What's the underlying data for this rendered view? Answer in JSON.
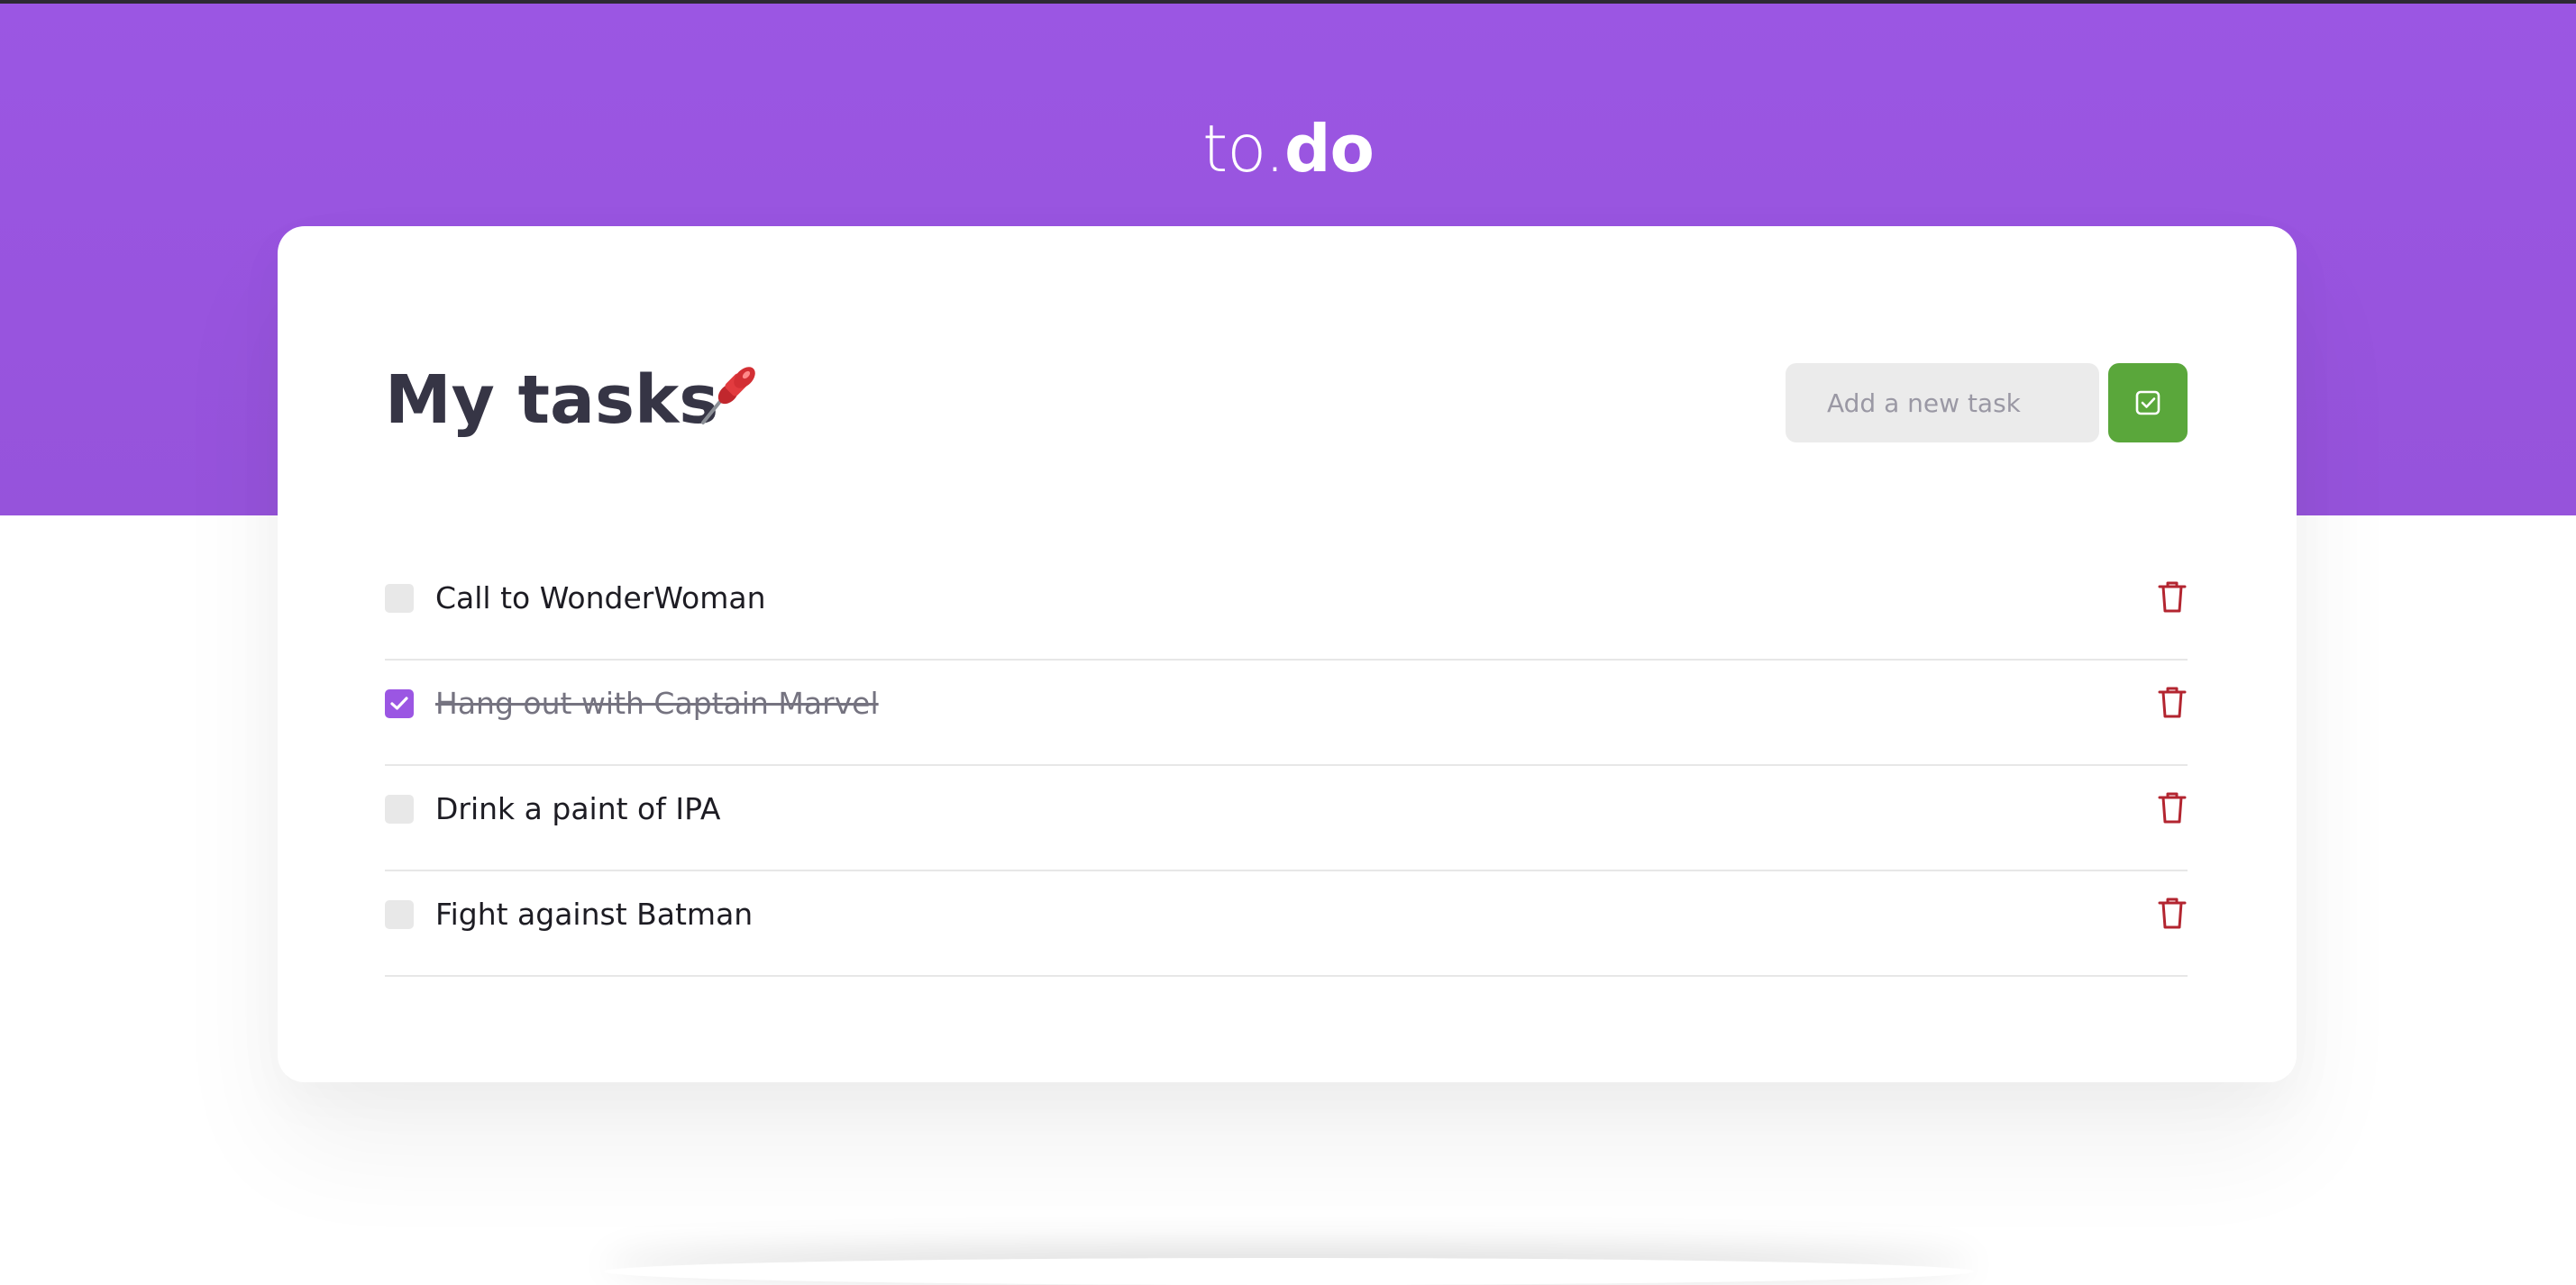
{
  "app": {
    "logo_light": "to.",
    "logo_bold": "do"
  },
  "card": {
    "title": "My tasks",
    "title_icon": "pushpin-icon"
  },
  "new_task": {
    "placeholder": "Add a new task",
    "value": "",
    "submit_icon": "check-square-icon"
  },
  "tasks": [
    {
      "label": "Call to WonderWoman",
      "completed": false
    },
    {
      "label": "Hang out with Captain Marvel",
      "completed": true
    },
    {
      "label": "Drink a paint of IPA",
      "completed": false
    },
    {
      "label": "Fight against Batman",
      "completed": false
    }
  ],
  "icons": {
    "checkbox": "checkmark-icon",
    "delete": "trash-icon"
  },
  "colors": {
    "brand_purple": "#9b56e3",
    "add_button_green": "#5aa73b",
    "delete_red": "#b32530",
    "title_text": "#363545"
  }
}
